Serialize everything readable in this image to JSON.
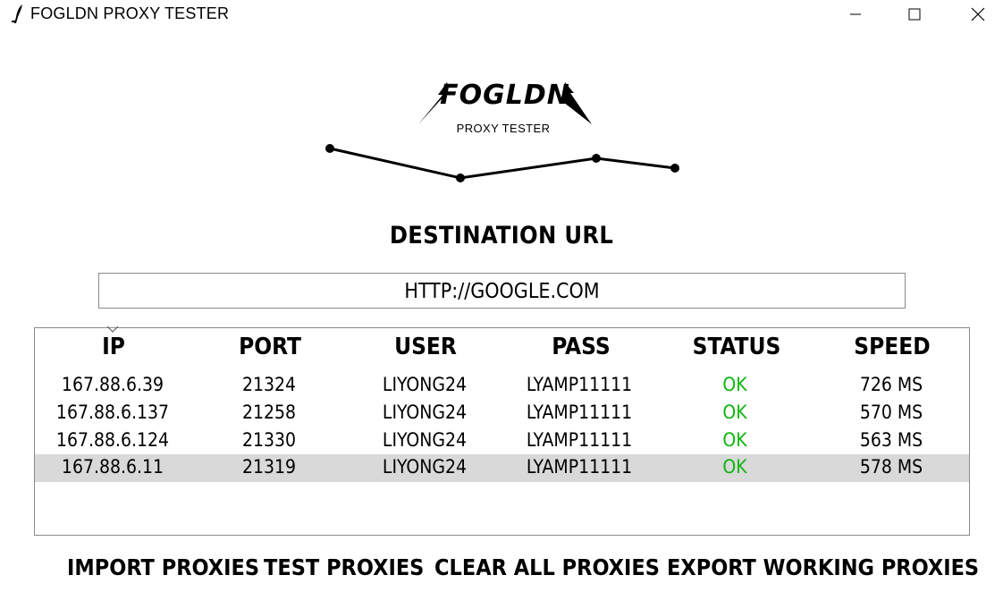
{
  "window": {
    "title": "FOGLDN PROXY TESTER",
    "icon": "feather-icon",
    "controls": [
      "minimize-icon",
      "maximize-icon",
      "close-icon"
    ]
  },
  "logo": {
    "wordmark": "FOGLDN",
    "subtitle": "PROXY TESTER"
  },
  "destination": {
    "label": "DESTINATION URL",
    "url": "HTTP://GOOGLE.COM"
  },
  "table": {
    "columns": [
      "IP",
      "PORT",
      "USER",
      "PASS",
      "STATUS",
      "SPEED"
    ],
    "sorted_column": "IP",
    "rows": [
      {
        "ip": "167.88.6.39",
        "port": "21324",
        "user": "LIYONG24",
        "pass": "LYAMP11111",
        "status": "OK",
        "speed": "726 MS"
      },
      {
        "ip": "167.88.6.137",
        "port": "21258",
        "user": "LIYONG24",
        "pass": "LYAMP11111",
        "status": "OK",
        "speed": "570 MS"
      },
      {
        "ip": "167.88.6.124",
        "port": "21330",
        "user": "LIYONG24",
        "pass": "LYAMP11111",
        "status": "OK",
        "speed": "563 MS"
      },
      {
        "ip": "167.88.6.11",
        "port": "21319",
        "user": "LIYONG24",
        "pass": "LYAMP11111",
        "status": "OK",
        "speed": "578 MS"
      }
    ],
    "selected_row": 3,
    "status_ok_color": "#11b511",
    "selected_row_color": "#d9d9d9"
  },
  "actions": {
    "import": "IMPORT PROXIES",
    "test": "TEST PROXIES",
    "clear": "CLEAR ALL PROXIES",
    "export": "EXPORT WORKING PROXIES"
  }
}
